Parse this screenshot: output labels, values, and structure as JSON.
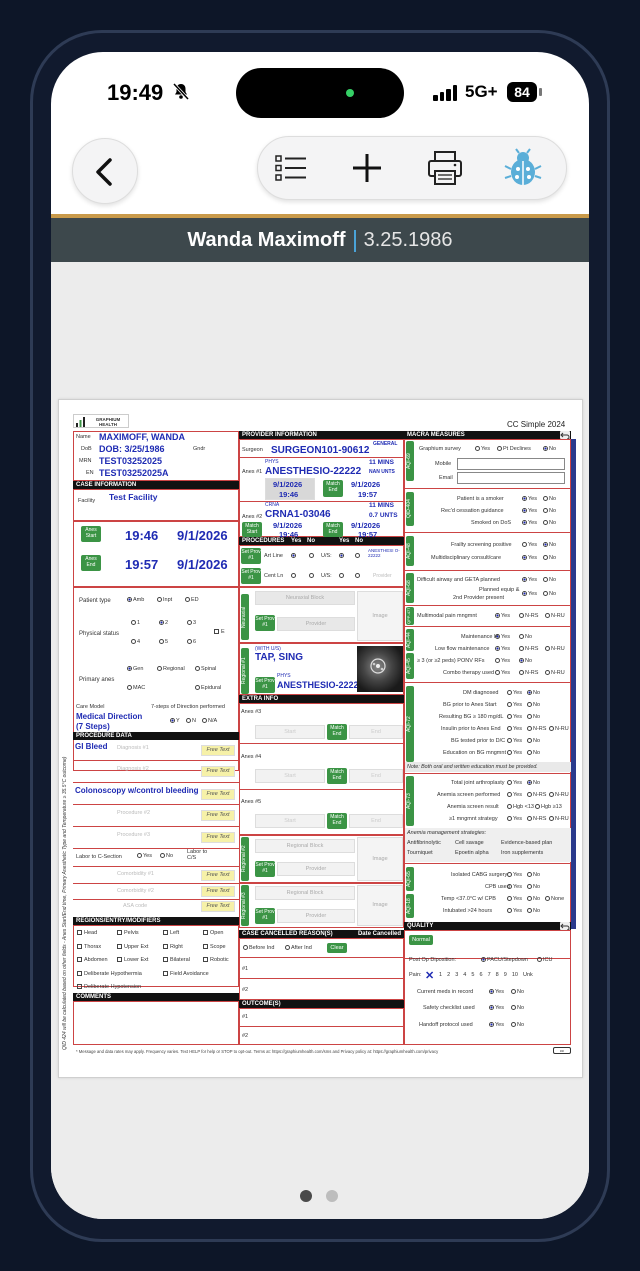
{
  "status": {
    "time": "19:49",
    "network": "5G+",
    "battery": "84"
  },
  "header": {
    "patient_name": "Wanda Maximoff",
    "dob": "3.25.1986"
  },
  "form": {
    "logo_text": "GRAPHIUM HEALTH",
    "form_title": "CC Simple 2024",
    "patient": {
      "name_label": "Name",
      "name": "MAXIMOFF, WANDA",
      "dob_label": "DoB",
      "dob": "DOB: 3/25/1986",
      "gndr_label": "Gndr",
      "mrn_label": "MRN",
      "mrn": "TEST03252025",
      "en_label": "EN",
      "en": "TEST03252025A"
    },
    "case_info": {
      "header": "CASE INFORMATION",
      "facility_label": "Facility",
      "facility": "Test Facility",
      "anes_start_btn": "Anes Start",
      "anes_start_time": "19:46",
      "anes_start_date": "9/1/2026",
      "anes_end_btn": "Anes End",
      "anes_end_time": "19:57",
      "anes_end_date": "9/1/2026"
    },
    "patient_type": {
      "label": "Patient type",
      "opts": [
        "Amb",
        "Inpt",
        "ED"
      ]
    },
    "physical_status": {
      "label": "Physical status",
      "opts": [
        "1",
        "2",
        "3",
        "4",
        "5",
        "6",
        "E"
      ]
    },
    "primary_anes": {
      "label": "Primary anes",
      "opts": [
        "Gen",
        "Regional",
        "Spinal",
        "MAC",
        "Epidural"
      ]
    },
    "care_model": {
      "label": "Care Model",
      "sub": "7-steps of Direction performed",
      "value": "Medical Direction",
      "value2": "(7 Steps)",
      "opts": [
        "Y",
        "N",
        "N/A"
      ]
    },
    "procedure": {
      "header": "PROCEDURE DATA",
      "dx1_value": "GI Bleed",
      "dx1_ph": "Diagnosis #1",
      "dx2_ph": "Diagnosis #2",
      "free": "Free Text",
      "proc1_value": "Colonoscopy w/control bleeding",
      "proc1_ph": "Procedure #1",
      "proc2_ph": "Procedure #2",
      "proc3_ph": "Procedure #3",
      "labor_label": "Labor to C-Section",
      "labor_yes": "Yes",
      "labor_no": "No",
      "labor_btn": "Labor to C/S",
      "comorb1": "Comorbidity #1",
      "comorb2": "Comorbidity #2",
      "asa": "ASA code"
    },
    "regions": {
      "header": "REGIONS/ENTRY/MODIFIERS",
      "items": [
        "Head",
        "Pelvis",
        "Left",
        "Open",
        "Thorax",
        "Upper Ext",
        "Right",
        "Scope",
        "Abdomen",
        "Lower Ext",
        "Bilateral",
        "Robotic"
      ],
      "hypo": "Deliberate Hypothermia",
      "field": "Field Avoidance",
      "hypot": "Deliberate Hypotension"
    },
    "comments": {
      "header": "COMMENTS"
    },
    "footer": "* Message and data rates may apply. Frequency varies. Text HELP for help or STOP to opt-out. Terms at: https://graphiumhealth.com/sms and Privacy policy at: https://graphiumhealth.com/privacy",
    "side_text": "QID 424 will be calculated based on other fields - Anes Start/End time, Primary Anesthetic Type and Temperature ≥ 35.5°C outcome)",
    "provider": {
      "header": "PROVIDER INFORMATION",
      "general": "GENERAL",
      "surgeon_label": "Surgeon",
      "surgeon": "SURGEON101-90612",
      "anes1_label": "Anes #1",
      "anes1_type": "PHYS",
      "anes1": "ANESTHESIO-22222",
      "anes1_mins": "11 MINS",
      "anes1_units": "NAN UNTS",
      "anes1_start_date": "9/1/2026",
      "anes1_start_time": "19:46",
      "anes1_end_date": "9/1/2026",
      "anes1_end_time": "19:57",
      "match_end": "Match End",
      "match_start": "Match Start",
      "anes2_label": "Anes #2",
      "anes2_type": "CRNA",
      "anes2": "CRNA1-03046",
      "anes2_mins": "11 MINS",
      "anes2_units": "0.7 UNTS",
      "anes2_start_date": "9/1/2026",
      "anes2_start_time": "19:46",
      "anes2_end_date": "9/1/2026",
      "anes2_end_time": "19:57"
    },
    "procedures": {
      "header": "PROCEDURES",
      "yes": "Yes",
      "no": "No",
      "set_prov": "Set Prov #1",
      "art_line": "Art Line",
      "us": "U/S:",
      "cent_ln": "Cent Ln",
      "us2": "U/S:",
      "anes_code": "ANESTHESI O-22222",
      "provider": "Provider"
    },
    "neuraxial": {
      "tab": "Neuraxial",
      "block": "Neuraxial Block",
      "provider": "Provider",
      "image": "Image",
      "set_prov": "Set Prov #1"
    },
    "regional1": {
      "tab": "Regional #1",
      "with_us": "(WITH U/S)",
      "block": "TAP, SING",
      "type": "PHYS",
      "provider": "ANESTHESIO-22222",
      "set_prov": "Set Prov #1"
    },
    "extra": {
      "header": "EXTRA INFO",
      "anes3": "Anes #3",
      "anes4": "Anes #4",
      "anes5": "Anes #5",
      "start": "Start",
      "end": "End",
      "match_end": "Match End"
    },
    "regional2": {
      "tab": "Regional #2",
      "block": "Regional Block",
      "provider": "Provider",
      "image": "Image",
      "set_prov": "Set Prov #1"
    },
    "regional3": {
      "tab": "Regional #3",
      "block": "Regional Block",
      "provider": "Provider",
      "image": "Image",
      "set_prov": "Set Prov #1"
    },
    "cancel": {
      "header": "CASE CANCELLED REASON(S)",
      "date_label": "Date Cancelled",
      "before": "Before Ind",
      "after": "After Ind",
      "clear": "Clear",
      "r1": "#1",
      "r2": "#2"
    },
    "outcomes": {
      "header": "OUTCOME(S)",
      "r1": "#1",
      "r2": "#2"
    },
    "macra": {
      "header": "MACRA MEASURES",
      "graphium_survey": "Graphium survey",
      "gs_opts": [
        "Yes",
        "Pt Declines",
        "No"
      ],
      "mobile": "Mobile",
      "email": "Email",
      "smoker": "Patient is a smoker",
      "rec_cess": "Rec'd cessation guidance",
      "smoked_dos": "Smoked on DoS",
      "frailty": "Frailty screening positive",
      "multidisc": "Multidisciplinary consult/care",
      "difficult": "Difficult airway and GETA planned",
      "planned1": "Planned equip &",
      "planned2": "2nd Provider present",
      "multimodal": "Multimodal pain mngmnt",
      "maint_ia": "Maintenance IA",
      "low_flow": "Low flow maintenance",
      "ponv": "≥ 3 (or ≥2 peds) PONV RFs",
      "combo": "Combo therapy used",
      "dm": "DM diagnosed",
      "bg_prior": "BG prior to Anes Start",
      "resulting": "Resulting BG ≥ 180 mg/dL",
      "insulin": "Insulin prior to Anes End",
      "bg_tested": "BG tested prior to D/C",
      "edu": "Education on BG mngmnt",
      "note": "Note: Both oral and written education must be provided.",
      "total_joint": "Total joint arthroplasty",
      "anemia_scr": "Anemia screen performed",
      "anemia_res": "Anemia screen result",
      "hgb1": "Hgb <13",
      "hgb2": "Hgb ≥13",
      "mngmnt": "≥1 mngmnt strategy",
      "anemia_strat": "Anemia management strategies:",
      "strats": [
        "Antifibrinolytic",
        "Cell savage",
        "Evidence-based plan",
        "Tourniquet",
        "Epoetin alpha",
        "Iron supplements"
      ],
      "cabg": "Isolated CABG surgery",
      "cpb": "CPB used",
      "temp": "Temp <37.0°C w/ CPB",
      "intubated": "Intubated >24 hours",
      "yes": "Yes",
      "no": "No",
      "nrs": "N-RS",
      "nru": "N-RU",
      "none": "None",
      "unk": "Unk",
      "tabs": [
        "AQI-69",
        "QID-404",
        "AQI-48",
        "AQI-68",
        "QPP-477",
        "AQI-44",
        "AQI-45",
        "AQI-72",
        "AQI-73",
        "AQI-65",
        "AQI-18"
      ]
    },
    "quality": {
      "header": "QUALITY",
      "normal": "Normal",
      "post_op": "Post Op Diposition:",
      "pacu": "PACU/Stepdown",
      "icu": "ICU",
      "pain": "Pain:",
      "pain_vals": [
        "1",
        "2",
        "3",
        "4",
        "5",
        "6",
        "7",
        "8",
        "9",
        "10",
        "Unk"
      ],
      "meds": "Current meds in record",
      "safety": "Safety checklist used",
      "handoff": "Handoff protocol used"
    }
  },
  "colors": {
    "accent_green": "#3b9445",
    "handwriting": "#1f2bb3",
    "header_bar": "#3d484c",
    "gold": "#c99a4a"
  }
}
